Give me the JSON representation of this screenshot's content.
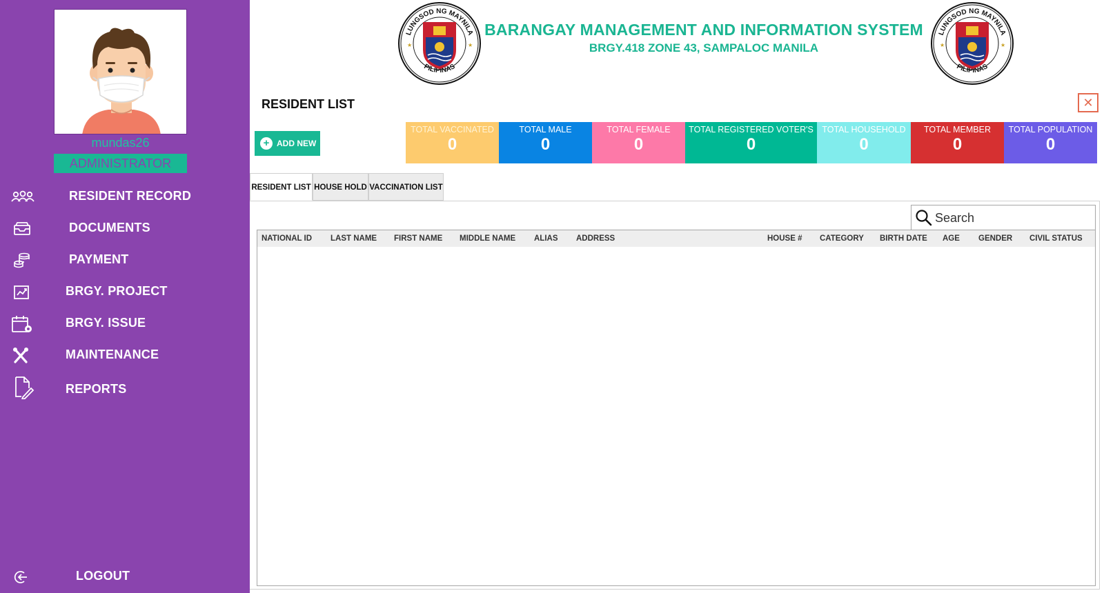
{
  "user": {
    "name": "mundas26",
    "role": "ADMINISTRATOR"
  },
  "nav": [
    {
      "label": "RESIDENT RECORD",
      "icon": "people-icon"
    },
    {
      "label": "DOCUMENTS",
      "icon": "inbox-tray-icon"
    },
    {
      "label": "PAYMENT",
      "icon": "coins-icon"
    },
    {
      "label": "BRGY. PROJECT",
      "icon": "chart-icon"
    },
    {
      "label": "BRGY. ISSUE",
      "icon": "calendar-gear-icon"
    },
    {
      "label": "MAINTENANCE",
      "icon": "tools-icon"
    },
    {
      "label": "REPORTS",
      "icon": "edit-document-icon"
    }
  ],
  "logout_label": "LOGOUT",
  "header": {
    "title": "BARANGAY MANAGEMENT AND INFORMATION SYSTEM",
    "subtitle": "BRGY.418 ZONE 43, SAMPALOC MANILA",
    "seal_text_top": "LUNGSOD NG MAYNILA",
    "seal_text_bottom": "PILIPINAS"
  },
  "page_title": "RESIDENT LIST",
  "close_glyph": "✕",
  "add_new_label": "ADD NEW",
  "stats": [
    {
      "label": "TOTAL VACCINATED",
      "value": "0",
      "color": "#fdcb6e"
    },
    {
      "label": "TOTAL MALE",
      "value": "0",
      "color": "#0984e3"
    },
    {
      "label": "TOTAL FEMALE",
      "value": "0",
      "color": "#fd79a8"
    },
    {
      "label": "TOTAL REGISTERED VOTER'S",
      "value": "0",
      "color": "#00b894"
    },
    {
      "label": "TOTAL HOUSEHOLD",
      "value": "0",
      "color": "#81ecec"
    },
    {
      "label": "TOTAL MEMBER",
      "value": "0",
      "color": "#d63031"
    },
    {
      "label": "TOTAL POPULATION",
      "value": "0",
      "color": "#6c5ce7"
    }
  ],
  "tabs": [
    "RESIDENT LIST",
    "HOUSE HOLD",
    "VACCINATION LIST"
  ],
  "active_tab": 0,
  "search": {
    "placeholder": "Search",
    "value": ""
  },
  "table": {
    "columns": [
      "NATIONAL ID",
      "LAST NAME",
      "FIRST NAME",
      "MIDDLE NAME",
      "ALIAS",
      "ADDRESS",
      "HOUSE #",
      "CATEGORY",
      "BIRTH DATE",
      "AGE",
      "GENDER",
      "CIVIL STATUS"
    ],
    "rows": []
  },
  "colors": {
    "sidebar": "#8a44ae",
    "accent": "#19b894",
    "close": "#e46a4f"
  }
}
